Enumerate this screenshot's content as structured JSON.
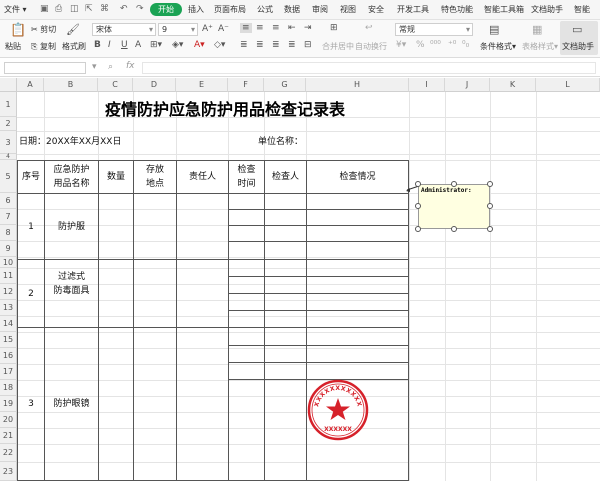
{
  "menu": {
    "file": "文件",
    "tabs": [
      "开始",
      "插入",
      "页面布局",
      "公式",
      "数据",
      "审阅",
      "视图",
      "安全",
      "开发工具",
      "特色功能",
      "智能工具箱",
      "文档助手",
      "智能"
    ]
  },
  "toolbar": {
    "cut": "剪切",
    "paste": "粘贴",
    "copy": "复制",
    "format_painter": "格式刷",
    "font": "宋体",
    "font_size": "9",
    "merge": "合并居中",
    "wrap": "自动换行",
    "number_format": "常规",
    "cond_format": "条件格式",
    "table_style": "表格样式",
    "doc_assistant": "文档助手"
  },
  "formula": {
    "fx": "fx"
  },
  "columns": [
    "A",
    "B",
    "C",
    "D",
    "E",
    "F",
    "G",
    "H",
    "I",
    "J",
    "K",
    "L"
  ],
  "rows": [
    "1",
    "2",
    "3",
    "4",
    "5",
    "6",
    "7",
    "8",
    "9",
    "10",
    "11",
    "12",
    "13",
    "14",
    "15",
    "16",
    "17",
    "18",
    "19",
    "20",
    "21",
    "22",
    "23"
  ],
  "sheet": {
    "title": "疫情防护应急防护用品检查记录表",
    "date_label": "日期：20XX年XX月XX日",
    "unit_label": "单位名称：",
    "headers": {
      "seq": "序号",
      "item_line1": "应急防护",
      "item_line2": "用品名称",
      "qty": "数量",
      "loc_line1": "存放",
      "loc_line2": "地点",
      "owner": "责任人",
      "time_line1": "检查",
      "time_line2": "时间",
      "inspector": "检查人",
      "status": "检查情况"
    },
    "items": [
      {
        "seq": "1",
        "name1": "防护服",
        "name2": ""
      },
      {
        "seq": "2",
        "name1": "过滤式",
        "name2": "防毒面具"
      },
      {
        "seq": "3",
        "name1": "防护眼镜",
        "name2": ""
      }
    ]
  },
  "comment": {
    "author": "Administrator:"
  },
  "stamp": {
    "top_text": "XXXXXXXXXXX",
    "bottom_text": "XXXXXX",
    "color": "#d6212a"
  },
  "colors": {
    "accent": "#1aa354"
  }
}
